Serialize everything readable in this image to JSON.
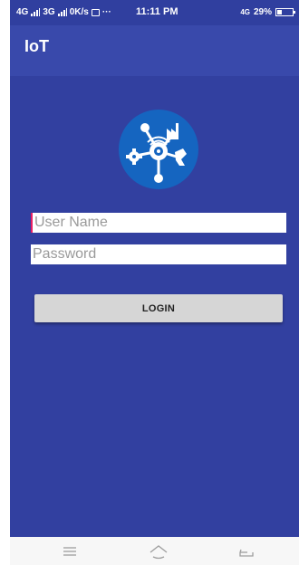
{
  "status_bar": {
    "network_1": "4G",
    "network_2": "3G",
    "speed": "0K/s",
    "dots": "···",
    "time": "11:11 PM",
    "network_right": "4G",
    "battery": "29%"
  },
  "app_bar": {
    "title": "IoT"
  },
  "logo": {
    "icon": "iot-network-icon",
    "color": "#1565c0"
  },
  "form": {
    "username_placeholder": "User Name",
    "password_placeholder": "Password",
    "login_label": "LOGIN"
  },
  "nav_bar": {
    "menu_icon": "menu-icon",
    "home_icon": "home-icon",
    "back_icon": "back-icon"
  },
  "colors": {
    "status_bar": "#303f9f",
    "app_bar": "#3949ab",
    "background": "#3240a0",
    "button": "#d6d6d6",
    "cursor": "#e91e63"
  }
}
